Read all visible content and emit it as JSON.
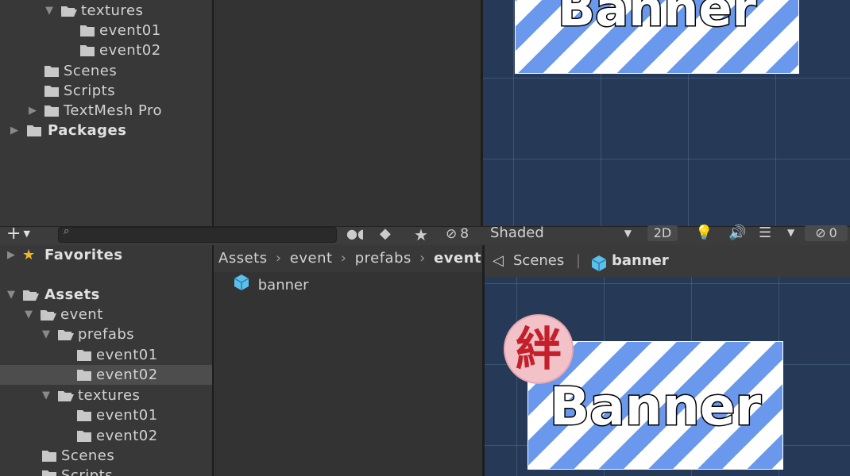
{
  "top_tree": {
    "items": [
      {
        "label": "textures",
        "expanded": true
      },
      {
        "label": "event01"
      },
      {
        "label": "event02"
      },
      {
        "label": "Scenes"
      },
      {
        "label": "Scripts"
      },
      {
        "label": "TextMesh Pro"
      },
      {
        "label": "Packages"
      }
    ]
  },
  "toolbar": {
    "add_label": "+",
    "hidden_count": "8",
    "shading_mode": "Shaded",
    "mode_2d": "2D",
    "scene_hidden_count": "0"
  },
  "favorites": {
    "label": "Favorites"
  },
  "bottom_tree": {
    "items": [
      {
        "label": "Assets"
      },
      {
        "label": "event"
      },
      {
        "label": "prefabs"
      },
      {
        "label": "event01"
      },
      {
        "label": "event02",
        "selected": true
      },
      {
        "label": "textures"
      },
      {
        "label": "event01"
      },
      {
        "label": "event02"
      },
      {
        "label": "Scenes"
      },
      {
        "label": "Scripts"
      }
    ]
  },
  "breadcrumb": {
    "items": [
      "Assets",
      "event",
      "prefabs",
      "event"
    ]
  },
  "assets": [
    {
      "label": "banner",
      "icon": "prefab-cube-icon"
    }
  ],
  "scene_header": {
    "scenes_label": "Scenes",
    "prefab_label": "banner"
  },
  "scene": {
    "banner_text": "Banner",
    "badge_text": "絆",
    "stripe_color": "#6a98ec",
    "background_color": "#263a58"
  }
}
